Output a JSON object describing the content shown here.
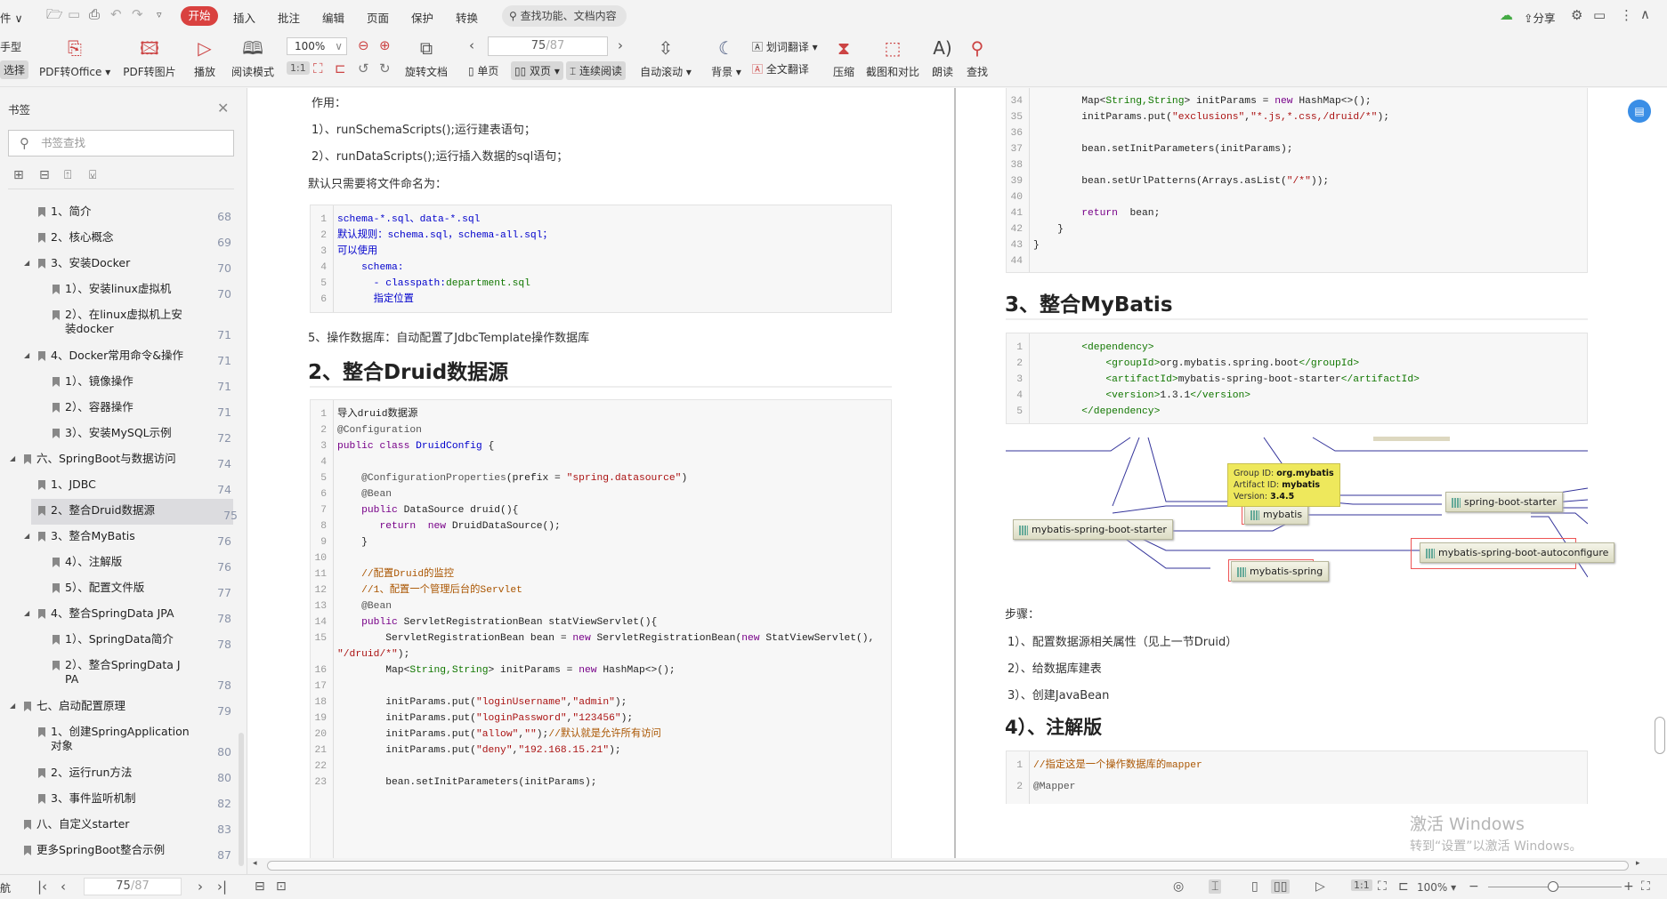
{
  "menubar": {
    "file_label": "件",
    "tabs": [
      "开始",
      "插入",
      "批注",
      "编辑",
      "页面",
      "保护",
      "转换"
    ],
    "active_tab": "开始",
    "search_placeholder": "查找功能、文档内容",
    "share_label": "分享"
  },
  "toolbar": {
    "left_cut_top": "手型",
    "left_cut_bottom": "选择",
    "pdf_to_office": "PDF转Office",
    "pdf_to_image": "PDF转图片",
    "play": "播放",
    "read_mode": "阅读模式",
    "zoom_value": "100%",
    "rotate_doc": "旋转文档",
    "page_current": "75",
    "page_total": "/87",
    "single_page": "单页",
    "double_page": "双页",
    "continuous": "连续阅读",
    "auto_scroll": "自动滚动",
    "background": "背景",
    "word_translate": "划词翻译",
    "full_translate": "全文翻译",
    "compress": "压缩",
    "screenshot_compare": "截图和对比",
    "read_aloud": "朗读",
    "find": "查找"
  },
  "sidebar": {
    "title": "书签",
    "search_placeholder": "书签查找",
    "items": [
      {
        "level": 1,
        "text": "1、简介",
        "page": "68"
      },
      {
        "level": 1,
        "text": "2、核心概念",
        "page": "69"
      },
      {
        "level": 1,
        "text": "3、安装Docker",
        "page": "70",
        "expanded": true
      },
      {
        "level": 2,
        "text": "1）、安装linux虚拟机",
        "page": "70"
      },
      {
        "level": 2,
        "text": "2）、在linux虚拟机上安",
        "text2": "装docker",
        "page": "71"
      },
      {
        "level": 1,
        "text": "4、Docker常用命令&操作",
        "page": "71",
        "expanded": true
      },
      {
        "level": 2,
        "text": "1）、镜像操作",
        "page": "71"
      },
      {
        "level": 2,
        "text": "2）、容器操作",
        "page": "71"
      },
      {
        "level": 2,
        "text": "3）、安装MySQL示例",
        "page": "72"
      },
      {
        "level": 0,
        "text": "六、SpringBoot与数据访问",
        "page": "74",
        "expanded": true
      },
      {
        "level": 1,
        "text": "1、JDBC",
        "page": "74"
      },
      {
        "level": 1,
        "text": "2、整合Druid数据源",
        "page": "75",
        "selected": true
      },
      {
        "level": 1,
        "text": "3、整合MyBatis",
        "page": "76",
        "expanded": true
      },
      {
        "level": 2,
        "text": "4）、注解版",
        "page": "76"
      },
      {
        "level": 2,
        "text": "5）、配置文件版",
        "page": "77"
      },
      {
        "level": 1,
        "text": "4、整合SpringData JPA",
        "page": "78",
        "expanded": true
      },
      {
        "level": 2,
        "text": "1）、SpringData简介",
        "page": "78"
      },
      {
        "level": 2,
        "text": "2）、整合SpringData J",
        "text2": "PA",
        "page": "78"
      },
      {
        "level": 0,
        "text": "七、启动配置原理",
        "page": "79",
        "expanded": true
      },
      {
        "level": 1,
        "text": "1、创建SpringApplication",
        "text2": "对象",
        "page": "80"
      },
      {
        "level": 1,
        "text": "2、运行run方法",
        "page": "80"
      },
      {
        "level": 1,
        "text": "3、事件监听机制",
        "page": "82"
      },
      {
        "level": 0,
        "text": "八、自定义starter",
        "page": "83"
      },
      {
        "level": 0,
        "text": "更多SpringBoot整合示例",
        "page": "87"
      }
    ]
  },
  "navbar": {
    "label": "航",
    "page_current": "75",
    "page_total": "/87"
  },
  "left_page": {
    "para_effect": "作用：",
    "para_1": "1）、runSchemaScripts();运行建表语句；",
    "para_2": "2）、runDataScripts();运行插入数据的sql语句；",
    "para_default": "默认只需要将文件命名为：",
    "code_1": [
      {
        "n": "1",
        "tokens": [
          [
            "t",
            "schema-*.sql、data-*.sql"
          ]
        ]
      },
      {
        "n": "2",
        "tokens": [
          [
            "t",
            "默认规则：schema.sql，schema-all.sql；"
          ]
        ]
      },
      {
        "n": "3",
        "tokens": [
          [
            "t",
            "可以使用"
          ]
        ]
      },
      {
        "n": "4",
        "tokens": [
          [
            "t",
            "    schema:"
          ]
        ]
      },
      {
        "n": "5",
        "tokens": [
          [
            "t",
            "      - classpath:"
          ],
          [
            "g",
            "department.sql"
          ]
        ]
      },
      {
        "n": "6",
        "tokens": [
          [
            "t",
            "      指定位置"
          ]
        ]
      }
    ],
    "para_5": "5、操作数据库：自动配置了JdbcTemplate操作数据库",
    "heading": "2、整合Druid数据源",
    "code_2": [
      {
        "n": "1",
        "tokens": [
          [
            "p0",
            "导入druid数据源"
          ]
        ]
      },
      {
        "n": "2",
        "tokens": [
          [
            "a",
            "@Configuration"
          ]
        ]
      },
      {
        "n": "3",
        "tokens": [
          [
            "k",
            "public class "
          ],
          [
            "t",
            "DruidConfig"
          ],
          [
            "p0",
            " {"
          ]
        ]
      },
      {
        "n": "4",
        "tokens": []
      },
      {
        "n": "5",
        "tokens": [
          [
            "a",
            "    @ConfigurationProperties"
          ],
          [
            "p0",
            "(prefix = "
          ],
          [
            "s",
            "\"spring.datasource\""
          ],
          [
            "p0",
            ")"
          ]
        ]
      },
      {
        "n": "6",
        "tokens": [
          [
            "a",
            "    @Bean"
          ]
        ]
      },
      {
        "n": "7",
        "tokens": [
          [
            "k",
            "    public "
          ],
          [
            "p0",
            "DataSource druid(){"
          ]
        ]
      },
      {
        "n": "8",
        "tokens": [
          [
            "k",
            "       return  new "
          ],
          [
            "p0",
            "DruidDataSource();"
          ]
        ]
      },
      {
        "n": "9",
        "tokens": [
          [
            "p0",
            "    }"
          ]
        ]
      },
      {
        "n": "10",
        "tokens": []
      },
      {
        "n": "11",
        "tokens": [
          [
            "cm",
            "    //配置Druid的监控"
          ]
        ]
      },
      {
        "n": "12",
        "tokens": [
          [
            "cm",
            "    //1、配置一个管理后台的Servlet"
          ]
        ]
      },
      {
        "n": "13",
        "tokens": [
          [
            "a",
            "    @Bean"
          ]
        ]
      },
      {
        "n": "14",
        "tokens": [
          [
            "k",
            "    public "
          ],
          [
            "p0",
            "ServletRegistrationBean statViewServlet(){"
          ]
        ]
      },
      {
        "n": "15",
        "tokens": [
          [
            "p0",
            "        ServletRegistrationBean bean = "
          ],
          [
            "k",
            "new "
          ],
          [
            "p0",
            "ServletRegistrationBean("
          ],
          [
            "k",
            "new "
          ],
          [
            "p0",
            "StatViewServlet(),"
          ]
        ],
        "wrap": [
          [
            "s",
            "\"/druid/*\""
          ],
          [
            "p0",
            ");"
          ]
        ]
      },
      {
        "n": "16",
        "tokens": [
          [
            "p0",
            "        Map<"
          ],
          [
            "g",
            "String,String"
          ],
          [
            "p0",
            "> initParams = "
          ],
          [
            "k",
            "new "
          ],
          [
            "p0",
            "HashMap<>();"
          ]
        ]
      },
      {
        "n": "17",
        "tokens": []
      },
      {
        "n": "18",
        "tokens": [
          [
            "p0",
            "        initParams.put("
          ],
          [
            "s",
            "\"loginUsername\""
          ],
          [
            "p0",
            ","
          ],
          [
            "s",
            "\"admin\""
          ],
          [
            "p0",
            ");"
          ]
        ]
      },
      {
        "n": "19",
        "tokens": [
          [
            "p0",
            "        initParams.put("
          ],
          [
            "s",
            "\"loginPassword\""
          ],
          [
            "p0",
            ","
          ],
          [
            "s",
            "\"123456\""
          ],
          [
            "p0",
            ");"
          ]
        ]
      },
      {
        "n": "20",
        "tokens": [
          [
            "p0",
            "        initParams.put("
          ],
          [
            "s",
            "\"allow\""
          ],
          [
            "p0",
            ","
          ],
          [
            "s",
            "\"\""
          ],
          [
            "p0",
            ");"
          ],
          [
            "cm",
            "//默认就是允许所有访问"
          ]
        ]
      },
      {
        "n": "21",
        "tokens": [
          [
            "p0",
            "        initParams.put("
          ],
          [
            "s",
            "\"deny\""
          ],
          [
            "p0",
            ","
          ],
          [
            "s",
            "\"192.168.15.21\""
          ],
          [
            "p0",
            ");"
          ]
        ]
      },
      {
        "n": "22",
        "tokens": []
      },
      {
        "n": "23",
        "tokens": [
          [
            "p0",
            "        bean.setInitParameters(initParams);"
          ]
        ]
      }
    ]
  },
  "right_page": {
    "code_top": [
      {
        "n": "34",
        "tokens": [
          [
            "p0",
            "        Map<"
          ],
          [
            "g",
            "String,String"
          ],
          [
            "p0",
            "> initParams = "
          ],
          [
            "k",
            "new "
          ],
          [
            "p0",
            "HashMap<>();"
          ]
        ]
      },
      {
        "n": "35",
        "tokens": [
          [
            "p0",
            "        initParams.put("
          ],
          [
            "s",
            "\"exclusions\""
          ],
          [
            "p0",
            ","
          ],
          [
            "s",
            "\"*.js,*.css,/druid/*\""
          ],
          [
            "p0",
            ");"
          ]
        ]
      },
      {
        "n": "36",
        "tokens": []
      },
      {
        "n": "37",
        "tokens": [
          [
            "p0",
            "        bean.setInitParameters(initParams);"
          ]
        ]
      },
      {
        "n": "38",
        "tokens": []
      },
      {
        "n": "39",
        "tokens": [
          [
            "p0",
            "        bean.setUrlPatterns(Arrays.asList("
          ],
          [
            "s",
            "\"/*\""
          ],
          [
            "p0",
            "));"
          ]
        ]
      },
      {
        "n": "40",
        "tokens": []
      },
      {
        "n": "41",
        "tokens": [
          [
            "k",
            "        return  "
          ],
          [
            "p0",
            "bean;"
          ]
        ]
      },
      {
        "n": "42",
        "tokens": [
          [
            "p0",
            "    }"
          ]
        ]
      },
      {
        "n": "43",
        "tokens": [
          [
            "p0",
            "}"
          ]
        ]
      },
      {
        "n": "44",
        "tokens": []
      }
    ],
    "heading_mybatis": "3、整合MyBatis",
    "code_dep": [
      {
        "n": "1",
        "tokens": [
          [
            "tg",
            "        <dependency>"
          ]
        ]
      },
      {
        "n": "2",
        "tokens": [
          [
            "tg",
            "            <groupId>"
          ],
          [
            "p0",
            "org.mybatis.spring.boot"
          ],
          [
            "tg",
            "</groupId>"
          ]
        ]
      },
      {
        "n": "3",
        "tokens": [
          [
            "tg",
            "            <artifactId>"
          ],
          [
            "p0",
            "mybatis-spring-boot-starter"
          ],
          [
            "tg",
            "</artifactId>"
          ]
        ]
      },
      {
        "n": "4",
        "tokens": [
          [
            "tg",
            "            <version>"
          ],
          [
            "p0",
            "1.3.1"
          ],
          [
            "tg",
            "</version>"
          ]
        ]
      },
      {
        "n": "5",
        "tokens": [
          [
            "tg",
            "        </dependency>"
          ]
        ]
      }
    ],
    "diagram": {
      "nodes": {
        "starter": "mybatis-spring-boot-starter",
        "mybatis": "mybatis",
        "spring_boot_starter": "spring-boot-starter",
        "autoconfigure": "mybatis-spring-boot-autoconfigure",
        "mybatis_spring": "mybatis-spring"
      },
      "tooltip": {
        "group_label": "Group ID: ",
        "group_value": "org.mybatis",
        "artifact_label": "Artifact ID: ",
        "artifact_value": "mybatis",
        "version_label": "Version: ",
        "version_value": "3.4.5"
      }
    },
    "steps_label": "步骤：",
    "step_1": "1）、配置数据源相关属性（见上一节Druid）",
    "step_2": "2）、给数据库建表",
    "step_3": "3）、创建JavaBean",
    "heading_annotation": "4）、注解版",
    "code_mapper": [
      {
        "n": "1",
        "tokens": [
          [
            "cm",
            "//指定这是一个操作数据库的mapper"
          ]
        ]
      },
      {
        "n": "2",
        "tokens": [
          [
            "a",
            "@Mapper"
          ]
        ]
      }
    ]
  },
  "statusbar": {
    "zoom_value": "100%"
  },
  "watermark": {
    "line1": "激活 Windows",
    "line2": "转到“设置”以激活 Windows。"
  },
  "colors": {
    "accent": "#d9413f",
    "selection": "#dcdcdf",
    "link_blue": "#0000cc"
  }
}
